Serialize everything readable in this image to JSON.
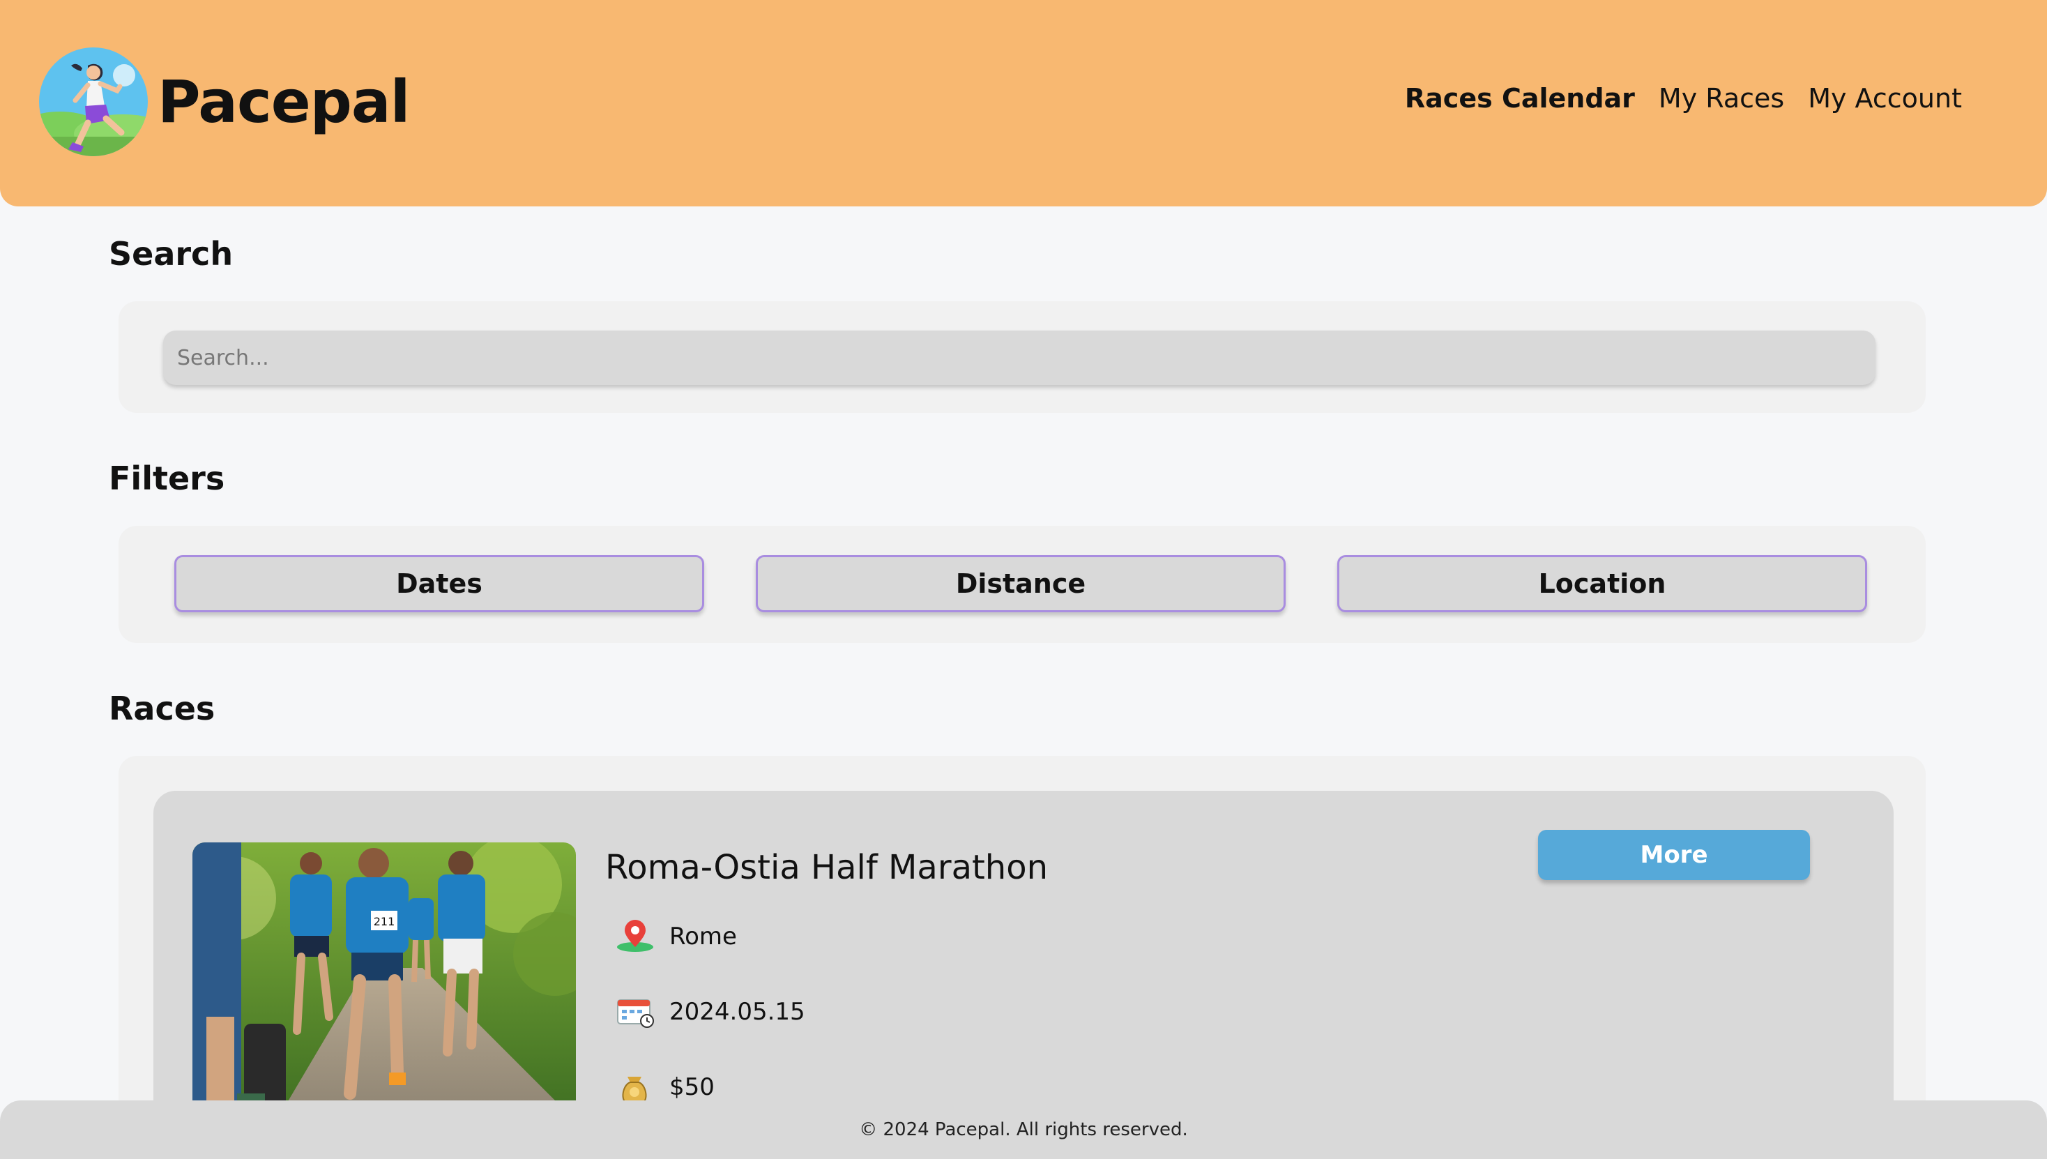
{
  "header": {
    "brand": "Pacepal",
    "nav": {
      "races_calendar": "Races Calendar",
      "my_races": "My Races",
      "my_account": "My Account"
    }
  },
  "search": {
    "title": "Search",
    "placeholder": "Search..."
  },
  "filters": {
    "title": "Filters",
    "dates": "Dates",
    "distance": "Distance",
    "location": "Location"
  },
  "races": {
    "title": "Races",
    "items": [
      {
        "name": "Roma-Ostia Half Marathon",
        "location": "Rome",
        "date": "2024.05.15",
        "price": "$50",
        "more_label": "More",
        "bib_number": "211"
      }
    ]
  },
  "footer": {
    "copyright": "© 2024 Pacepal. All rights reserved."
  },
  "colors": {
    "header_bg": "#f8b871",
    "panel_bg": "#f1f1f1",
    "card_bg": "#d9d9d9",
    "filter_border": "#a98de0",
    "more_button": "#56a9d9"
  }
}
